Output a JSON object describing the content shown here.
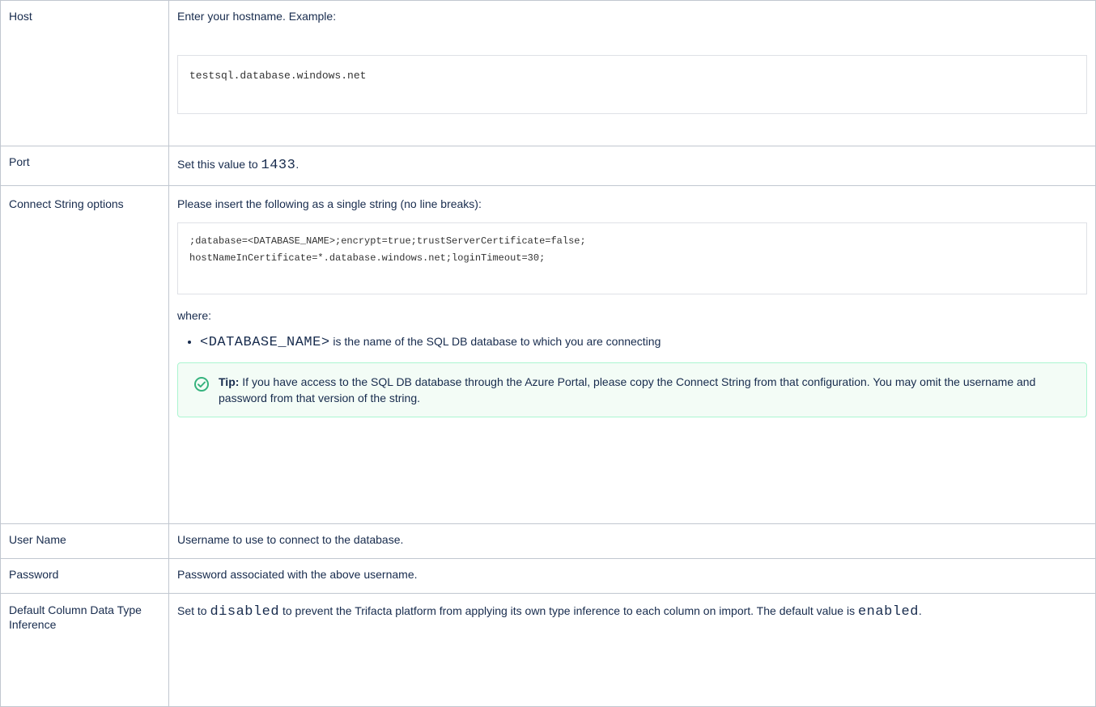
{
  "rows": {
    "host": {
      "label": "Host",
      "text": "Enter your hostname. Example:",
      "code": "testsql.database.windows.net"
    },
    "port": {
      "label": "Port",
      "text_before": "Set this value to ",
      "value": "1433",
      "text_after": "."
    },
    "connect": {
      "label": "Connect String options",
      "intro": "Please insert the following as a single string (no line breaks):",
      "code_line1": ";database=<DATABASE_NAME>;encrypt=true;trustServerCertificate=false;",
      "code_line2": "hostNameInCertificate=*.database.windows.net;loginTimeout=30;",
      "where": "where:",
      "bullet_code": "<DATABASE_NAME>",
      "bullet_text": " is the name of the SQL DB database to which you are connecting",
      "tip_label": "Tip:",
      "tip_text": " If you have access to the SQL DB database through the Azure Portal, please copy the Connect String from that configuration. You may omit the username and password from that version of the string.",
      "tip_icon": "check-circle-icon",
      "tip_color": "#36b37e"
    },
    "username": {
      "label": "User Name",
      "text": "Username to use to connect to the database."
    },
    "password": {
      "label": "Password",
      "text": "Password associated with the above username."
    },
    "inference": {
      "label": "Default Column Data Type Inference",
      "text_1": "Set to ",
      "code_1": "disabled",
      "text_2": " to prevent the Trifacta platform from applying its own type inference to each column on import. The default value is ",
      "code_2": "enabled",
      "text_3": "."
    }
  }
}
